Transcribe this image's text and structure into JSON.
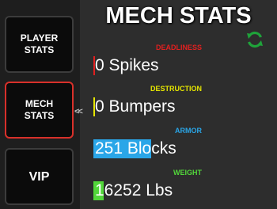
{
  "title": "MECH STATS",
  "sidebar": {
    "player_line1": "PLAYER",
    "player_line2": "STATS",
    "mech_line1": "MECH",
    "mech_line2": "STATS",
    "vip": "VIP",
    "arrow": "<<"
  },
  "refresh_icon": "refresh-icon",
  "colors": {
    "deadliness": "#e02020",
    "destruction": "#e6e600",
    "armor": "#2aa6e8",
    "weight": "#52d63a",
    "accent_refresh": "#1fa33a"
  },
  "stats": {
    "deadliness": {
      "label": "DEADLINESS",
      "value": "0 Spikes",
      "fill": 0.0
    },
    "destruction": {
      "label": "DESTRUCTION",
      "value": "0 Bumpers",
      "fill": 0.0
    },
    "armor": {
      "label": "ARMOR",
      "value": "251 Blocks",
      "fill": 0.3
    },
    "weight": {
      "label": "WEIGHT",
      "value": "16252 Lbs",
      "fill": 0.05
    }
  }
}
